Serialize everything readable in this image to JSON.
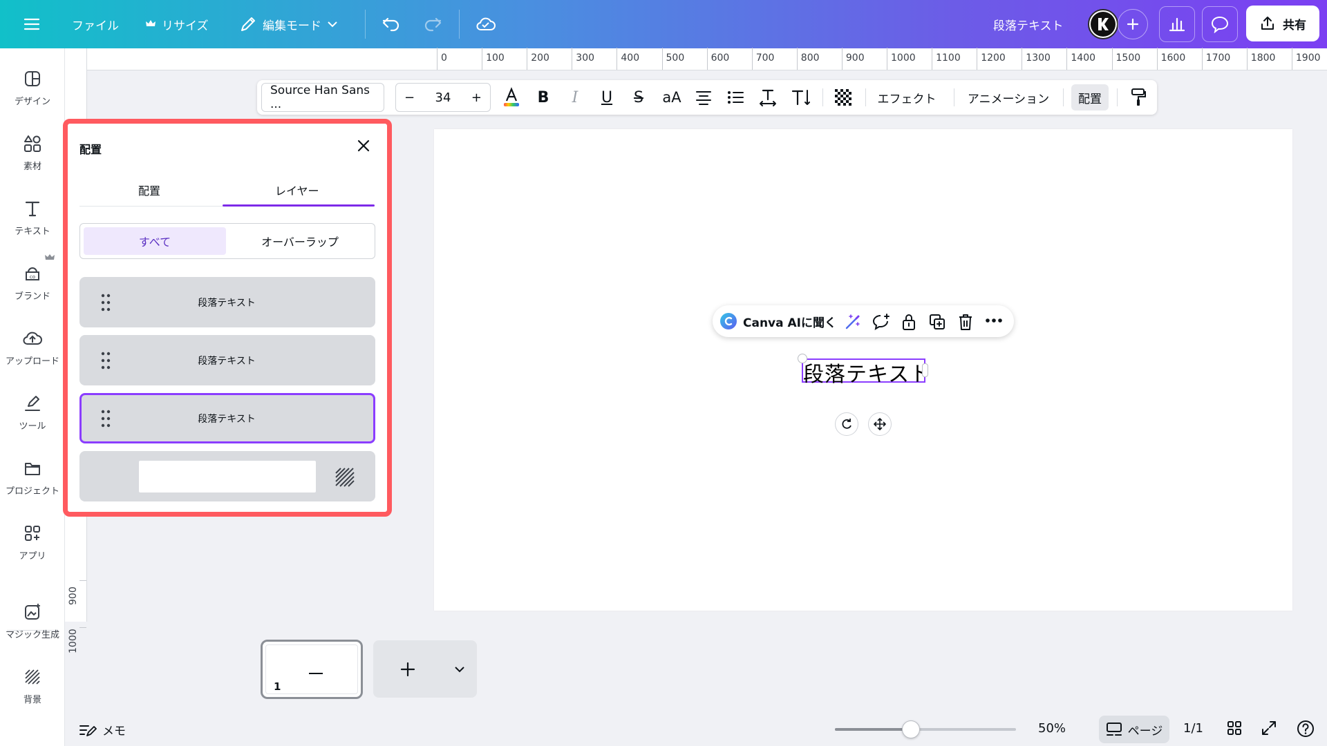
{
  "topbar": {
    "file_label": "ファイル",
    "resize_label": "リサイズ",
    "edit_mode_label": "編集モード",
    "doc_title": "段落テキスト",
    "share_label": "共有"
  },
  "rail": {
    "items": [
      {
        "label": "デザイン",
        "icon": "layout-icon"
      },
      {
        "label": "素材",
        "icon": "shapes-icon"
      },
      {
        "label": "テキスト",
        "icon": "text-icon"
      },
      {
        "label": "ブランド",
        "icon": "brand-icon"
      },
      {
        "label": "アップロード",
        "icon": "cloud-upload-icon"
      },
      {
        "label": "ツール",
        "icon": "pen-tool-icon"
      },
      {
        "label": "プロジェクト",
        "icon": "folder-icon"
      },
      {
        "label": "アプリ",
        "icon": "apps-icon"
      },
      {
        "label": "マジック生成",
        "icon": "magic-image-icon"
      },
      {
        "label": "背景",
        "icon": "background-hatch-icon"
      }
    ]
  },
  "ruler": {
    "top_labels": [
      "0",
      "100",
      "200",
      "300",
      "400",
      "500",
      "600",
      "700",
      "800",
      "900",
      "1000",
      "1100",
      "1200",
      "1300",
      "1400",
      "1500",
      "1600",
      "1700",
      "1800",
      "1900"
    ],
    "left_labels": [
      "900",
      "1000"
    ]
  },
  "text_toolbar": {
    "font_name": "Source Han Sans ...",
    "font_size": "34",
    "minus": "−",
    "plus": "+",
    "bold": "B",
    "italic": "I",
    "underline": "U",
    "strike": "S",
    "case": "aA",
    "effects_label": "エフェクト",
    "animation_label": "アニメーション",
    "position_label": "配置"
  },
  "panel": {
    "title": "配置",
    "tabs": [
      {
        "label": "配置",
        "active": false
      },
      {
        "label": "レイヤー",
        "active": true
      }
    ],
    "filters": [
      {
        "label": "すべて",
        "active": true
      },
      {
        "label": "オーバーラップ",
        "active": false
      }
    ],
    "layers": [
      {
        "label": "段落テキスト",
        "selected": false
      },
      {
        "label": "段落テキスト",
        "selected": false
      },
      {
        "label": "段落テキスト",
        "selected": true
      }
    ]
  },
  "canvas": {
    "ask_ai_label": "Canva AIに聞く",
    "selected_text": "段落テキスト"
  },
  "pages": {
    "current_number": "1",
    "add_label": "+"
  },
  "footer": {
    "memo_label": "メモ",
    "zoom_label": "50%",
    "zoom_fraction": 0.42,
    "page_view_label": "ページ",
    "page_of": "1/1"
  },
  "colors": {
    "accent": "#8b3dff",
    "highlight_outline": "#ff5a5f"
  }
}
